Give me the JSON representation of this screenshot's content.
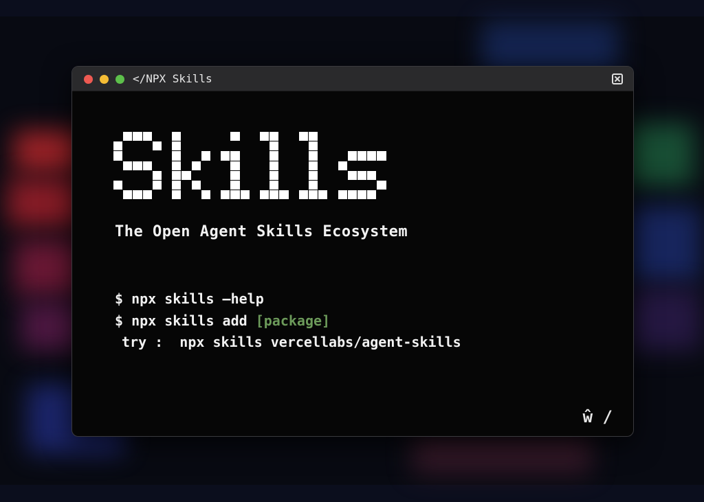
{
  "window": {
    "title": "</NPX Skills",
    "controls": {
      "close_icon": "close-icon",
      "red": "#ee5a52",
      "yellow": "#f5bd35",
      "green": "#5dc04b"
    }
  },
  "hero": {
    "word": "Skills",
    "tagline": "The Open Agent Skills Ecosystem"
  },
  "commands": {
    "line1": "$ npx skills —help",
    "line2_prefix": "$ npx skills add ",
    "line2_arg": "[package]",
    "line3": "try :  npx skills vercellabs/agent-skills"
  },
  "footer": {
    "logo": "ŵ /"
  },
  "colors": {
    "accent_green": "#6c9a5a",
    "text": "#f2f2f2",
    "window_bg": "#060606",
    "titlebar_bg": "#2a2a2c"
  }
}
